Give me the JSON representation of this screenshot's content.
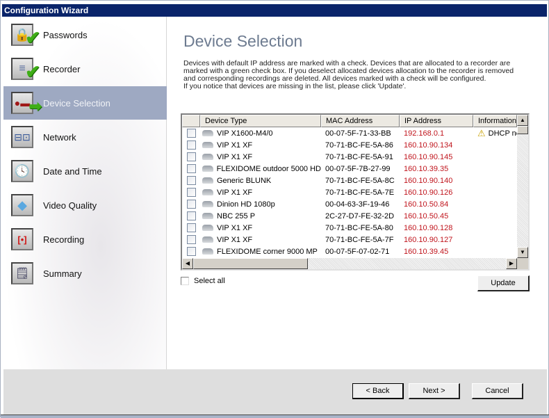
{
  "window": {
    "title": "Configuration Wizard"
  },
  "sidebar": {
    "items": [
      {
        "label": "Passwords",
        "icon": "lock-icon",
        "status": "completed"
      },
      {
        "label": "Recorder",
        "icon": "database-icon",
        "status": "completed"
      },
      {
        "label": "Device Selection",
        "icon": "camera-icon",
        "status": "current"
      },
      {
        "label": "Network",
        "icon": "network-icon",
        "status": "pending"
      },
      {
        "label": "Date and Time",
        "icon": "clock-icon",
        "status": "pending"
      },
      {
        "label": "Video Quality",
        "icon": "diamond-icon",
        "status": "pending"
      },
      {
        "label": "Recording",
        "icon": "record-icon",
        "status": "pending"
      },
      {
        "label": "Summary",
        "icon": "document-icon",
        "status": "pending"
      }
    ]
  },
  "main": {
    "title": "Device Selection",
    "description": [
      "Devices with default IP address are marked with a check. Devices that are allocated to a recorder are",
      "marked with a green check box. If you deselect allocated devices allocation to the recorder is removed",
      "and corresponding recordings are deleted. All devices marked with a check will be configured.",
      "If you notice that devices are missing in the list, please click 'Update'."
    ],
    "table": {
      "columns": [
        "",
        "Device Type",
        "MAC Address",
        "IP Address",
        "Information"
      ],
      "rows": [
        {
          "checked": false,
          "type": "VIP X1600-M4/0",
          "mac": "00-07-5F-71-33-BB",
          "ip": "192.168.0.1",
          "info": "DHCP nc",
          "warning": true
        },
        {
          "checked": false,
          "type": "VIP X1 XF",
          "mac": "70-71-BC-FE-5A-86",
          "ip": "160.10.90.134",
          "info": ""
        },
        {
          "checked": false,
          "type": "VIP X1 XF",
          "mac": "70-71-BC-FE-5A-91",
          "ip": "160.10.90.145",
          "info": ""
        },
        {
          "checked": false,
          "type": "FLEXIDOME outdoor 5000 HD",
          "mac": "00-07-5F-7B-27-99",
          "ip": "160.10.39.35",
          "info": ""
        },
        {
          "checked": false,
          "type": "Generic BLUNK",
          "mac": "70-71-BC-FE-5A-8C",
          "ip": "160.10.90.140",
          "info": ""
        },
        {
          "checked": false,
          "type": "VIP X1 XF",
          "mac": "70-71-BC-FE-5A-7E",
          "ip": "160.10.90.126",
          "info": ""
        },
        {
          "checked": false,
          "type": "Dinion HD 1080p",
          "mac": "00-04-63-3F-19-46",
          "ip": "160.10.50.84",
          "info": ""
        },
        {
          "checked": false,
          "type": "NBC 255 P",
          "mac": "2C-27-D7-FE-32-2D",
          "ip": "160.10.50.45",
          "info": ""
        },
        {
          "checked": false,
          "type": "VIP X1 XF",
          "mac": "70-71-BC-FE-5A-80",
          "ip": "160.10.90.128",
          "info": ""
        },
        {
          "checked": false,
          "type": "VIP X1 XF",
          "mac": "70-71-BC-FE-5A-7F",
          "ip": "160.10.90.127",
          "info": ""
        },
        {
          "checked": false,
          "type": "FLEXIDOME corner 9000 MP",
          "mac": "00-07-5F-07-02-71",
          "ip": "160.10.39.45",
          "info": ""
        }
      ]
    },
    "select_all_label": "Select all",
    "update_label": "Update"
  },
  "footer": {
    "back_label": "< Back",
    "next_label": "Next >",
    "cancel_label": "Cancel"
  },
  "colors": {
    "titlebar": "#0a246a",
    "active_nav": "#9ea9c2",
    "ip_text": "#c0141c",
    "page_title": "#6d7b90"
  }
}
